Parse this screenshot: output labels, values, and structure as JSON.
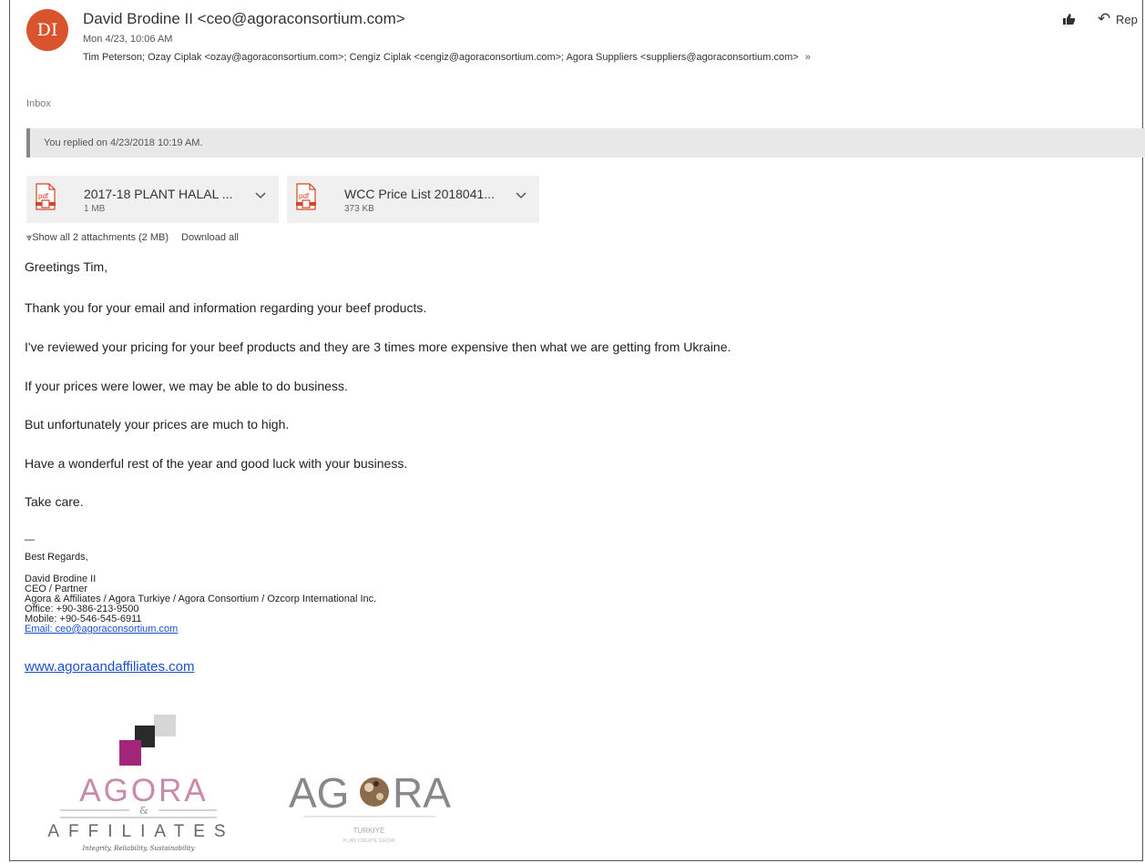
{
  "header": {
    "avatar_initials": "DI",
    "sender": "David Brodine II <ceo@agoraconsortium.com>",
    "date": "Mon 4/23, 10:06 AM",
    "recipients": "Tim Peterson; Ozay Ciplak <ozay@agoraconsortium.com>; Cengiz Ciplak <cengiz@agoraconsortium.com>; Agora Suppliers <suppliers@agoraconsortium.com>",
    "expand_glyph": "»",
    "reply_label": "Rep"
  },
  "folder": "Inbox",
  "replied_notice": "You replied on 4/23/2018 10:19 AM.",
  "attachments": [
    {
      "name": "2017-18 PLANT HALAL ...",
      "size": "1 MB",
      "icon": "pdf-icon"
    },
    {
      "name": "WCC Price List 2018041...",
      "size": "373 KB",
      "icon": "pdf-icon"
    }
  ],
  "attachment_actions": {
    "show_all": "Show all 2 attachments (2 MB)",
    "download_all": "Download all"
  },
  "body": [
    "Greetings Tim,",
    "Thank you for your email and information regarding your beef products.",
    "I've reviewed your pricing for your beef products and they are 3 times more expensive then what we are getting from Ukraine.",
    "If your prices were lower, we may be able to do business.",
    "But unfortunately your prices are much to high.",
    "Have a wonderful rest of the year and good luck with your business.",
    "Take care."
  ],
  "signature": {
    "dash": "—",
    "regards": "Best Regards,",
    "name": "David Brodine II",
    "title": "CEO / Partner",
    "company": "Agora & Affiliates / Agora Turkiye / Agora Consortium / Ozcorp International Inc.",
    "office": "Office: +90-386-213-9500",
    "mobile": "Mobile: +90-546-545-6911",
    "email": "Email: ceo@agoraconsortium.com",
    "website": "www.agoraandaffiliates.com"
  },
  "logos": {
    "affiliates": {
      "word1": "AGORA",
      "amp": "&",
      "word2": "AFFILIATES",
      "tagline": "Integrity, Reliability, Sustainability"
    },
    "turkiye": {
      "left": "AG",
      "right": "RA",
      "sub": "TURKIYE",
      "tagline": "PLAN CREATE GROW"
    }
  },
  "colors": {
    "avatar": "#d9542c",
    "link": "#1a4fd0",
    "pdf_red": "#d0462a",
    "logo_purple": "#a3257a",
    "logo_pink": "#c98bab"
  }
}
